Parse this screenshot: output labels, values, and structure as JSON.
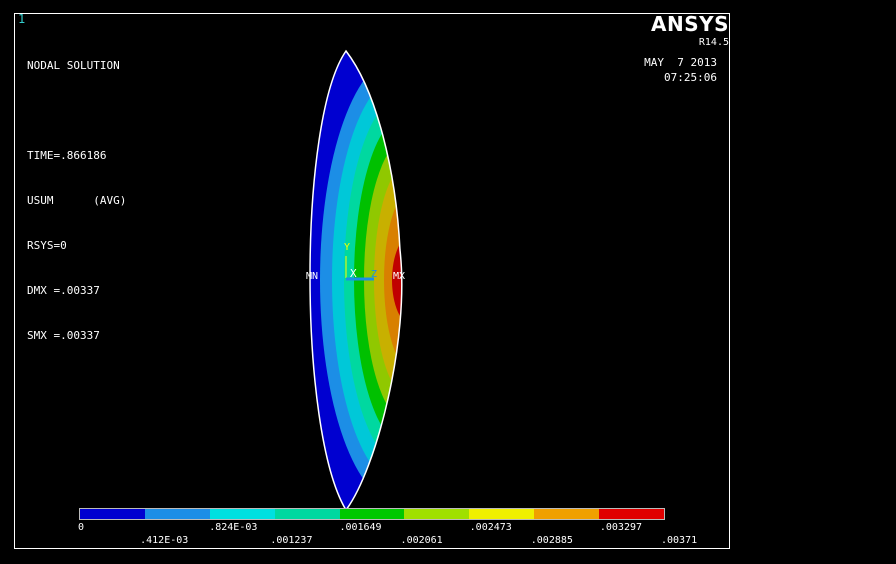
{
  "window_number": "1",
  "info_lines": [
    "NODAL SOLUTION",
    "",
    "TIME=.866186",
    "USUM      (AVG)",
    "RSYS=0",
    "DMX =.00337",
    "SMX =.00337"
  ],
  "brand": "ANSYS",
  "version": "R14.5",
  "date": "MAY  7 2013",
  "time": "07:25:06",
  "markers": {
    "min": "MN",
    "max": "MX"
  },
  "axes": {
    "y": "Y",
    "x": "X",
    "z": "Z"
  },
  "legend": {
    "colors": [
      "#0000d0",
      "#1c8ee6",
      "#00e0e0",
      "#00d8a0",
      "#00c800",
      "#a0e000",
      "#f0f000",
      "#f0a000",
      "#e00000"
    ],
    "top_labels": [
      "0",
      ".824E-03",
      ".001649",
      ".002473",
      ".003297"
    ],
    "bottom_labels": [
      ".412E-03",
      ".001237",
      ".002061",
      ".002885",
      ".00371"
    ]
  }
}
